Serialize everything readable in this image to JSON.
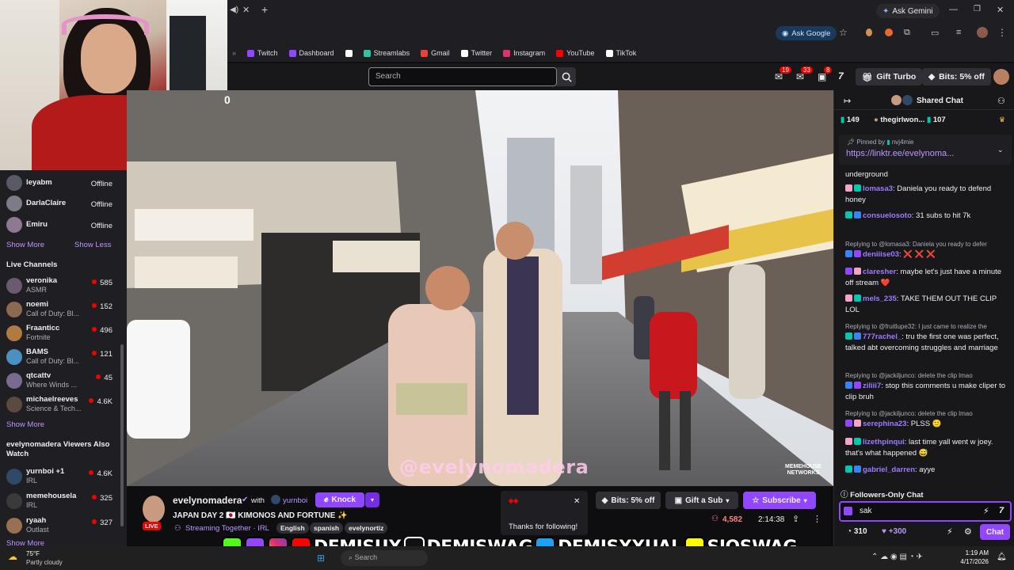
{
  "browser": {
    "ask_gemini": "Ask Gemini",
    "ask_google": "Ask Google",
    "bookmarks": [
      {
        "label": "Twitch",
        "color": "#9146ff"
      },
      {
        "label": "Dashboard",
        "color": "#9146ff"
      },
      {
        "label": "",
        "color": "#ffffff"
      },
      {
        "label": "Streamlabs",
        "color": "#31c3a2"
      },
      {
        "label": "Gmail",
        "color": "#ea4335"
      },
      {
        "label": "Twitter",
        "color": "#ffffff"
      },
      {
        "label": "Instagram",
        "color": "#e1306c"
      },
      {
        "label": "YouTube",
        "color": "#ff0000"
      },
      {
        "label": "TikTok",
        "color": "#ffffff"
      }
    ]
  },
  "topnav": {
    "search_placeholder": "Search",
    "notif_counts": [
      "19",
      "33",
      "8"
    ],
    "gift_turbo": "Gift Turbo",
    "bits_offer": "Bits: 5% off"
  },
  "sidebar": {
    "offline_channels": [
      {
        "name": "leyabm",
        "status": "Offline"
      },
      {
        "name": "DarlaClaire",
        "status": "Offline"
      },
      {
        "name": "Emiru",
        "status": "Offline"
      }
    ],
    "show_more": "Show More",
    "show_less": "Show Less",
    "live_title": "Live Channels",
    "live_channels": [
      {
        "name": "veronika",
        "category": "ASMR",
        "viewers": "585"
      },
      {
        "name": "noemi",
        "category": "Call of Duty: Bl...",
        "viewers": "152"
      },
      {
        "name": "Fraanticc",
        "category": "Fortnite",
        "viewers": "496"
      },
      {
        "name": "BAMS",
        "category": "Call of Duty: Bl...",
        "viewers": "121"
      },
      {
        "name": "qtcattv",
        "category": "Where Winds ...",
        "viewers": "45"
      },
      {
        "name": "michaelreeves",
        "category": "Science & Tech...",
        "viewers": "4.6K"
      }
    ],
    "show_more_2": "Show More",
    "also_watch_title": "evelynomadera Viewers Also Watch",
    "also_watch": [
      {
        "name": "yurnboi +1",
        "category": "IRL",
        "viewers": "4.6K"
      },
      {
        "name": "memehousela",
        "category": "IRL",
        "viewers": "325"
      },
      {
        "name": "ryaah",
        "category": "Outlast",
        "viewers": "327"
      }
    ],
    "show_more_3": "Show More"
  },
  "video": {
    "watermark": "@evelynomadera",
    "corner_logo": "MEMEHOUSE NETWORKS",
    "timestamp_fragment": "0"
  },
  "channel": {
    "name": "evelynomadera",
    "with": "with",
    "collab": "yurnboi",
    "knock": "Knock",
    "title": "JAPAN DAY 2 🇯🇵 KIMONOS AND FORTUNE ✨",
    "live": "LIVE",
    "streaming_together": "Streaming Together · IRL",
    "tags": [
      "English",
      "spanish",
      "evelynortiz"
    ],
    "bits": "Bits: 5% off",
    "gift_sub": "Gift a Sub",
    "subscribe": "Subscribe",
    "viewers": "4,582",
    "uptime": "2:14:38"
  },
  "follow_toast": {
    "text": "Thanks for following!"
  },
  "chat": {
    "header": "Shared Chat",
    "counts": [
      {
        "value": "149"
      },
      {
        "name": "thegirlwon...",
        "value": "107"
      }
    ],
    "pinned_by": "Pinned by",
    "pinned_user": "nvj4mie",
    "pinned_link": "https://linktr.ee/evelynoma...",
    "messages": [
      {
        "reply": "",
        "user": "",
        "color": "#efeff1",
        "text": "underground"
      },
      {
        "reply": "",
        "user": "lomasa3",
        "color": "#9d7bff",
        "text": ": Daniela you ready to defend honey"
      },
      {
        "reply": "",
        "user": "consuelosoto",
        "color": "#9d7bff",
        "text": ": 31 subs to hit 7k"
      },
      {
        "reply": "Replying to @lomasa3: Daniela you ready to defer",
        "user": "deniiise03",
        "color": "#9d7bff",
        "text": ": ❌ ❌ ❌"
      },
      {
        "reply": "",
        "user": "claresher",
        "color": "#9d7bff",
        "text": ": maybe let's just have a minute off stream ❤️"
      },
      {
        "reply": "",
        "user": "mels_235",
        "color": "#9d7bff",
        "text": ": TAKE THEM OUT THE CLIP LOL"
      },
      {
        "reply": "Replying to @fruitlupe32: I just came to realize the",
        "user": "777rachel_",
        "color": "#9d7bff",
        "text": ": tru the first one was perfect, talked abt overcoming struggles and marriage"
      },
      {
        "reply": "Replying to @jackiljunco: delete the clip lmao",
        "user": "ziliii7",
        "color": "#9d7bff",
        "text": ": stop this comments u make cliper to clip bruh"
      },
      {
        "reply": "Replying to @jackiljunco: delete the clip lmao",
        "user": "serephina23",
        "color": "#9d7bff",
        "text": ": PLSS 🙂"
      },
      {
        "reply": "",
        "user": "lizethpinqui",
        "color": "#9d7bff",
        "text": ": last time yall went w joey. that's what happened 😅"
      },
      {
        "reply": "",
        "user": "gabriel_darren",
        "color": "#9d7bff",
        "text": ": ayye"
      }
    ],
    "followers_only": "Followers-Only Chat",
    "input_value": "sak",
    "points": "310",
    "plus_points": "+300",
    "chat_button": "Chat"
  },
  "overlay": {
    "handles": [
      "DEMISUX",
      "DEMISWAG",
      "DEMISXXUAL",
      "SIOSWAG"
    ]
  },
  "taskbar": {
    "temp": "75°F",
    "weather": "Partly cloudy",
    "search": "Search",
    "time": "1:19 AM",
    "date": "4/17/2026"
  }
}
